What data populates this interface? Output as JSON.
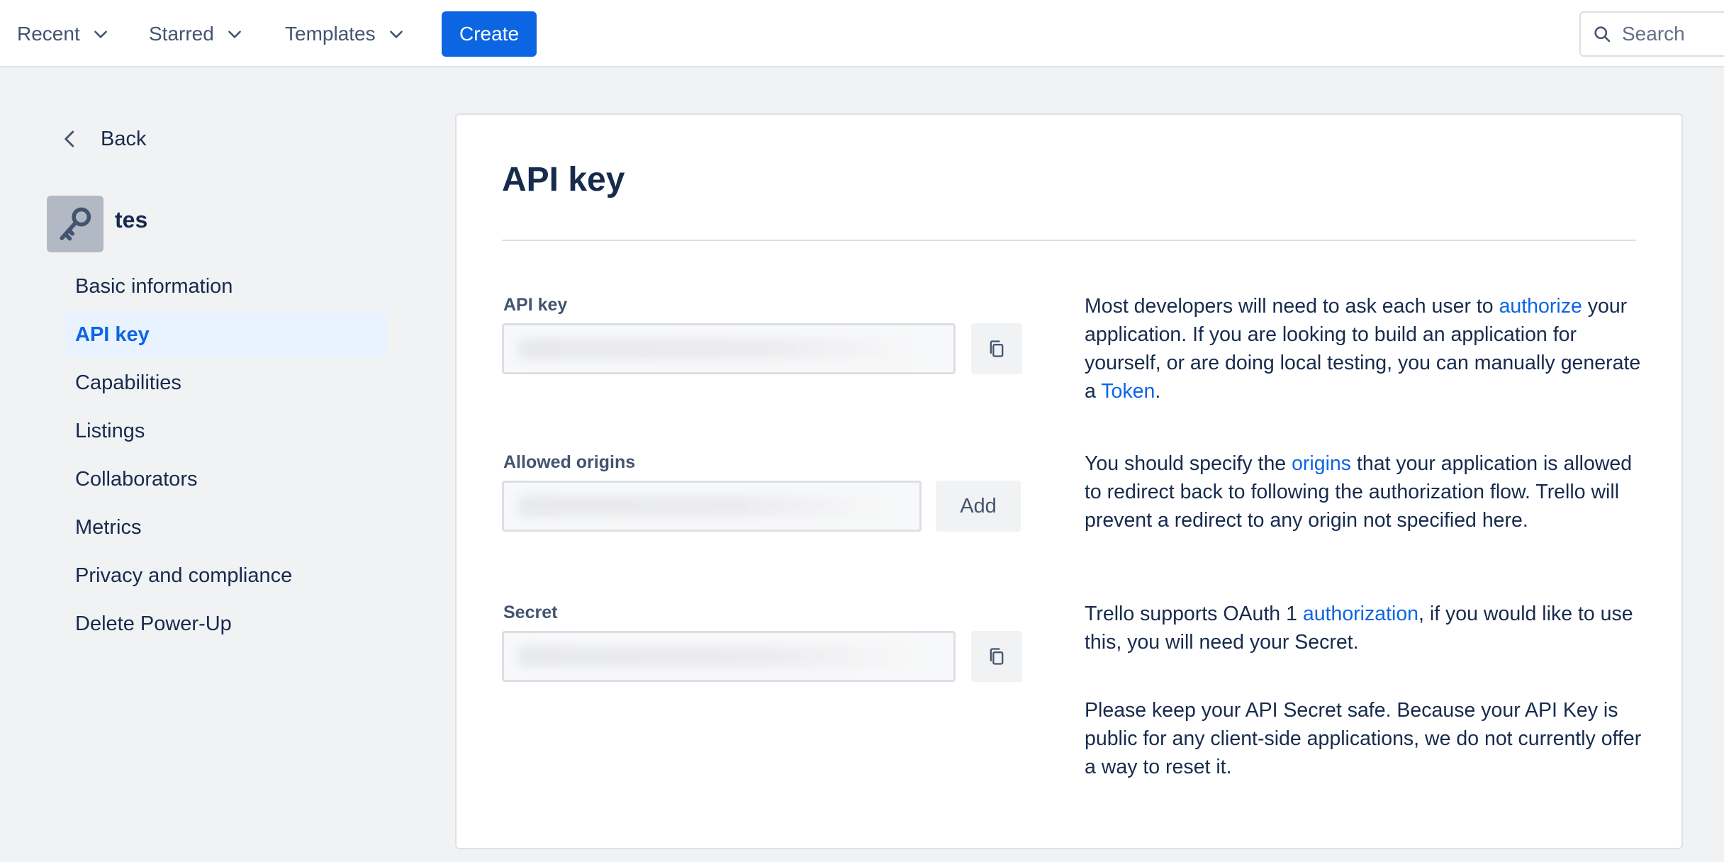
{
  "topbar": {
    "nav": [
      {
        "label": "Recent"
      },
      {
        "label": "Starred"
      },
      {
        "label": "Templates"
      }
    ],
    "create_label": "Create",
    "search_placeholder": "Search"
  },
  "sidebar": {
    "back_label": "Back",
    "app_name": "tes",
    "items": [
      {
        "label": "Basic information"
      },
      {
        "label": "API key",
        "active": true
      },
      {
        "label": "Capabilities"
      },
      {
        "label": "Listings"
      },
      {
        "label": "Collaborators"
      },
      {
        "label": "Metrics"
      },
      {
        "label": "Privacy and compliance"
      },
      {
        "label": "Delete Power-Up"
      }
    ]
  },
  "main": {
    "title": "API key",
    "api_key": {
      "label": "API key",
      "help": {
        "t1": "Most developers will need to ask each user to ",
        "link1": "authorize",
        "t2": " your application. If you are looking to build an application for yourself, or are doing local testing, you can manually generate a ",
        "link2": "Token",
        "t3": "."
      }
    },
    "allowed_origins": {
      "label": "Allowed origins",
      "add_label": "Add",
      "help": {
        "t1": "You should specify the ",
        "link1": "origins",
        "t2": " that your application is allowed to redirect back to following the authorization flow. Trello will prevent a redirect to any origin not specified here."
      }
    },
    "secret": {
      "label": "Secret",
      "help": {
        "t1": "Trello supports OAuth 1 ",
        "link1": "authorization",
        "t2": ", if you would like to use this, you will need your Secret."
      },
      "help2": "Please keep your API Secret safe. Because your API Key is public for any client-side applications, we do not currently offer a way to reset it."
    }
  },
  "colors": {
    "primary": "#0c66e4",
    "text": "#172b4d",
    "subtle_text": "#44546f",
    "page_bg": "#f1f2f4",
    "active_bg": "#e9f2ff"
  },
  "icons": [
    "chevron-down-icon",
    "search-icon",
    "chevron-left-icon",
    "key-icon",
    "copy-icon"
  ]
}
